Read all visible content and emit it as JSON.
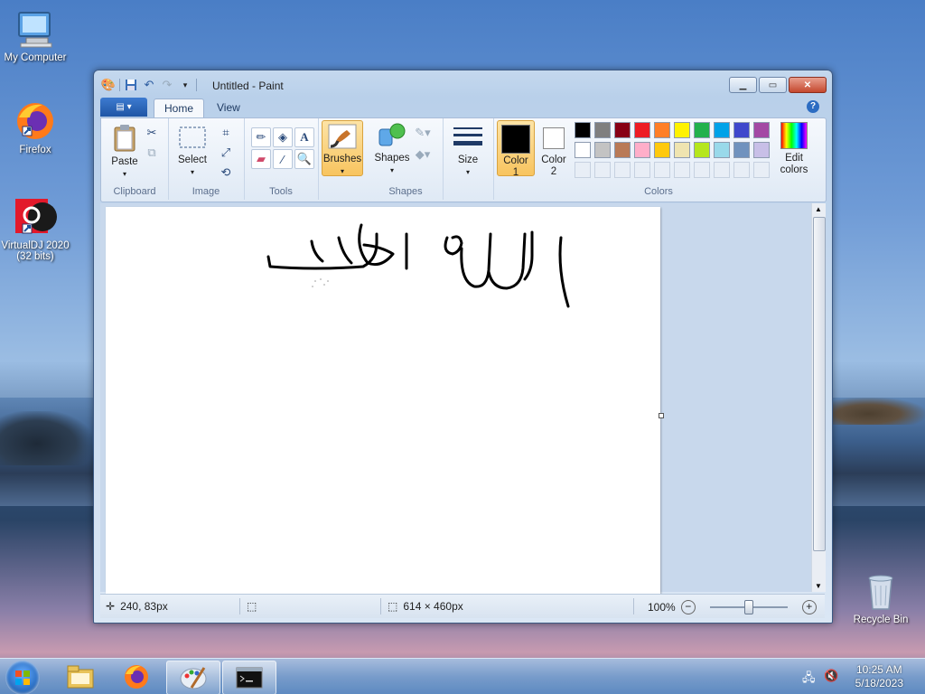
{
  "desktop": {
    "icons": [
      {
        "label": "My Computer",
        "icon": "computer-icon"
      },
      {
        "label": "Firefox",
        "icon": "firefox-icon"
      },
      {
        "label": "VirtualDJ 2020 (32 bits)",
        "icon": "virtualdj-icon"
      },
      {
        "label": "Recycle Bin",
        "icon": "recycle-bin-icon"
      }
    ]
  },
  "window": {
    "title": "Untitled - Paint",
    "tabs": [
      "Home",
      "View"
    ],
    "active_tab": "Home"
  },
  "ribbon": {
    "clipboard": {
      "label": "Clipboard",
      "paste": "Paste"
    },
    "image": {
      "label": "Image",
      "select": "Select"
    },
    "tools": {
      "label": "Tools"
    },
    "brushes": {
      "label": "Brushes"
    },
    "shapes": {
      "label": "Shapes",
      "button": "Shapes"
    },
    "size": {
      "label": "Size"
    },
    "colors": {
      "label": "Colors",
      "color1": "Color\n1",
      "color1_l1": "Color",
      "color1_l2": "1",
      "color2_l1": "Color",
      "color2_l2": "2",
      "edit_colors_l1": "Edit",
      "edit_colors_l2": "colors",
      "color1_value": "#000000",
      "color2_value": "#ffffff",
      "palette_row1": [
        "#000000",
        "#7f7f7f",
        "#880015",
        "#ed1c24",
        "#ff7f27",
        "#fff200",
        "#22b14c",
        "#00a2e8",
        "#3f48cc",
        "#a349a4"
      ],
      "palette_row2": [
        "#ffffff",
        "#c3c3c3",
        "#b97a57",
        "#ffaec9",
        "#ffc90e",
        "#efe4b0",
        "#b5e61d",
        "#99d9ea",
        "#7092be",
        "#c8bfe7"
      ]
    }
  },
  "status": {
    "cursor_pos": "240, 83px",
    "canvas_size": "614 × 460px",
    "zoom": "100%"
  },
  "taskbar": {
    "items": [
      "explorer-icon",
      "firefox-icon",
      "paint-icon",
      "cmd-icon"
    ],
    "time": "10:25 AM",
    "date": "5/18/2023"
  }
}
